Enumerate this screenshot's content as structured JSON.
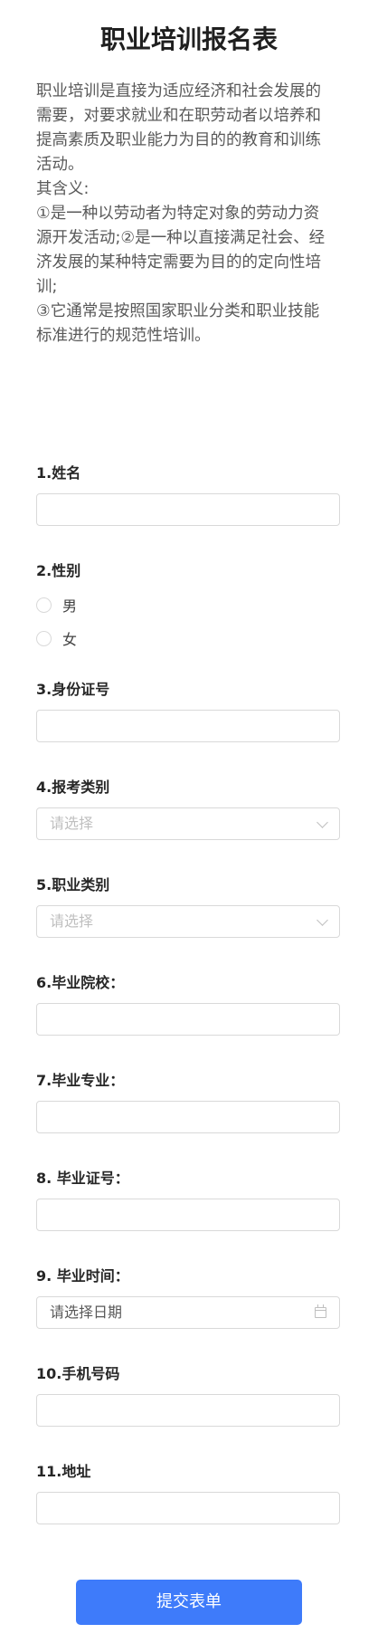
{
  "form": {
    "title": "职业培训报名表",
    "intro": [
      "职业培训是直接为适应经济和社会发展的需要，对要求就业和在职劳动者以培养和提高素质及职业能力为目的的教育和训练活动。",
      "其含义:",
      "①是一种以劳动者为特定对象的劳动力资源开发活动;②是一种以直接满足社会、经济发展的某种特定需要为目的的定向性培训;",
      "③它通常是按照国家职业分类和职业技能标准进行的规范性培训。"
    ],
    "fields": {
      "name": {
        "label": "1.姓名",
        "value": ""
      },
      "gender": {
        "label": "2.性别",
        "options": [
          "男",
          "女"
        ]
      },
      "id_number": {
        "label": "3.身份证号",
        "value": ""
      },
      "exam_category": {
        "label": "4.报考类别",
        "placeholder": "请选择"
      },
      "job_category": {
        "label": "5.职业类别",
        "placeholder": "请选择"
      },
      "school": {
        "label": "6.毕业院校：",
        "value": ""
      },
      "major": {
        "label": "7.毕业专业：",
        "value": ""
      },
      "cert_number": {
        "label": "8. 毕业证号：",
        "value": ""
      },
      "grad_date": {
        "label": "9. 毕业时间：",
        "placeholder": "请选择日期",
        "icon": "calendar-icon"
      },
      "phone": {
        "label": "10.手机号码",
        "value": ""
      },
      "address": {
        "label": "11.地址",
        "value": ""
      }
    },
    "submit_label": "提交表单",
    "colors": {
      "accent": "#3e7bfa",
      "border": "#d9d9d9",
      "placeholder": "#bfbfbf"
    }
  }
}
